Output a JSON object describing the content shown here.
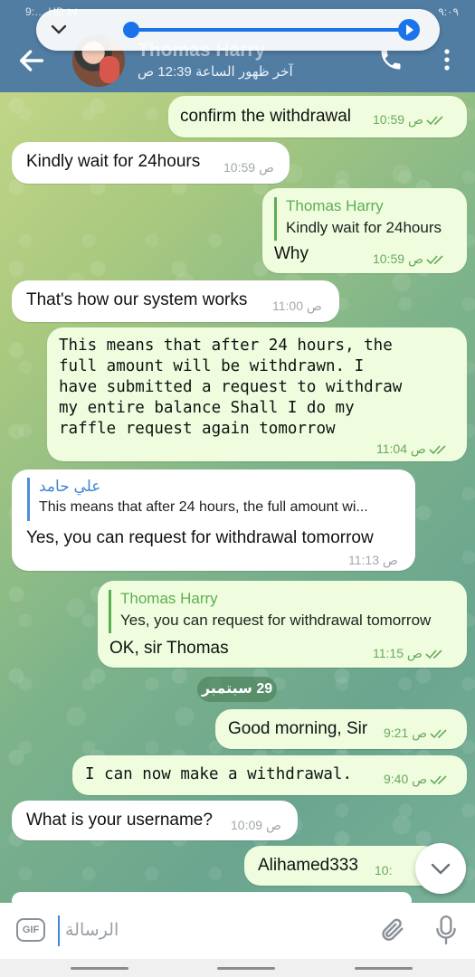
{
  "header": {
    "contact_name": "Thomas Harry",
    "last_seen": "آخر ظهور الساعة 12:39 ص"
  },
  "status_bar": {
    "left": "9:…  HD ⋈",
    "right": "۹:۰۹"
  },
  "messages": [
    {
      "dir": "out",
      "text": "confirm the withdrawal",
      "time": "10:59 ص",
      "read": true
    },
    {
      "dir": "in",
      "text": "Kindly wait for 24hours",
      "time": "10:59 ص"
    },
    {
      "dir": "out",
      "reply_name": "Thomas Harry",
      "reply_text": "Kindly wait for 24hours",
      "text": "Why",
      "time": "10:59 ص",
      "read": true
    },
    {
      "dir": "in",
      "text": "That's how our system works",
      "time": "11:00 ص"
    },
    {
      "dir": "out",
      "text": "This means that after 24 hours, the\nfull amount will be withdrawn. I\nhave submitted a request to withdraw\nmy entire balance Shall I do my\nraffle request again tomorrow",
      "time": "11:04 ص",
      "read": true
    },
    {
      "dir": "in",
      "reply_name": "علي حامد",
      "reply_text": "This means that after 24 hours, the full amount wi...",
      "text": "Yes, you can request for withdrawal tomorrow",
      "time": "11:13 ص"
    },
    {
      "dir": "out",
      "reply_name": "Thomas Harry",
      "reply_text": "Yes, you can request for withdrawal tomorrow",
      "text": "OK,  sir Thomas",
      "time": "11:15 ص",
      "read": true
    },
    {
      "dir": "out",
      "text": "Good morning, Sir",
      "time": "9:21 ص",
      "read": true
    },
    {
      "dir": "out",
      "text": "I can now make a withdrawal.",
      "time": "9:40 ص",
      "read": true
    },
    {
      "dir": "in",
      "text": "What is your username?",
      "time": "10:09 ص"
    },
    {
      "dir": "out",
      "text": "Alihamed333",
      "time": "10:",
      "read": true
    }
  ],
  "date_separator": "29 سبتمبر",
  "input": {
    "placeholder": "الرسالة",
    "gif_label": "GIF"
  },
  "colors": {
    "header": "#527da3",
    "outgoing_bubble": "#effdde",
    "incoming_bubble": "#ffffff",
    "accent": "#5cae53",
    "slider": "#1a73e8"
  },
  "icons": [
    "back-arrow-icon",
    "phone-icon",
    "more-vertical-icon",
    "chevron-down-icon",
    "gif-icon",
    "paperclip-icon",
    "microphone-icon",
    "double-check-icon"
  ]
}
